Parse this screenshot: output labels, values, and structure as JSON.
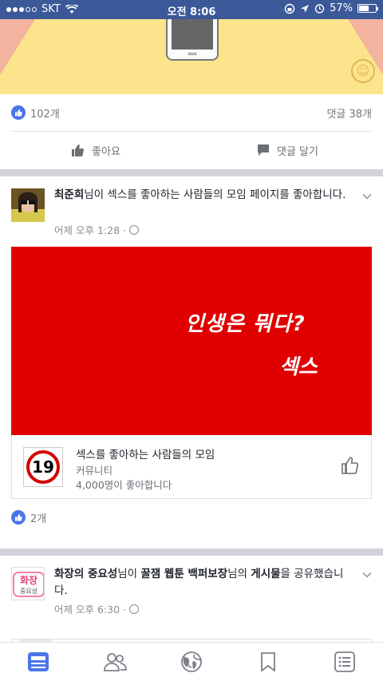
{
  "status_bar": {
    "carrier": "SKT",
    "time": "오전 8:06",
    "battery": "57%"
  },
  "prev_post": {
    "likes": "102개",
    "comments": "댓글 38개",
    "like_label": "좋아요",
    "comment_label": "댓글 달기"
  },
  "post1": {
    "author": "최준희",
    "action_suffix": "님이 섹스를 좋아하는 사람들의 모임 페이지를 좋아합니다.",
    "time": "어제 오후 1:28 ·",
    "image_line1": "인생은 뭐다?",
    "image_line2": "섹스",
    "card": {
      "badge": "19",
      "title": "섹스를 좋아하는 사람들의 모임",
      "category": "커뮤니티",
      "likes": "4,000명이 좋아합니다"
    },
    "like_count": "2개"
  },
  "post2": {
    "author": "화장의 중요성",
    "mid_text": "님이 ",
    "page": "꿀잼 웹툰 백퍼보장",
    "suffix": "님의 ",
    "object": "게시물",
    "end": "을 공유했습니다.",
    "time": "어제 오후 6:30 ·",
    "avatar_text1": "화장",
    "avatar_text2": "중요성"
  },
  "colors": {
    "facebook_blue": "#3b5998",
    "like_blue": "#4a76e8",
    "red": "#e00000"
  },
  "tabbar": {
    "icons": [
      "news-feed-icon",
      "friends-icon",
      "globe-icon",
      "bookmark-icon",
      "menu-icon"
    ]
  }
}
